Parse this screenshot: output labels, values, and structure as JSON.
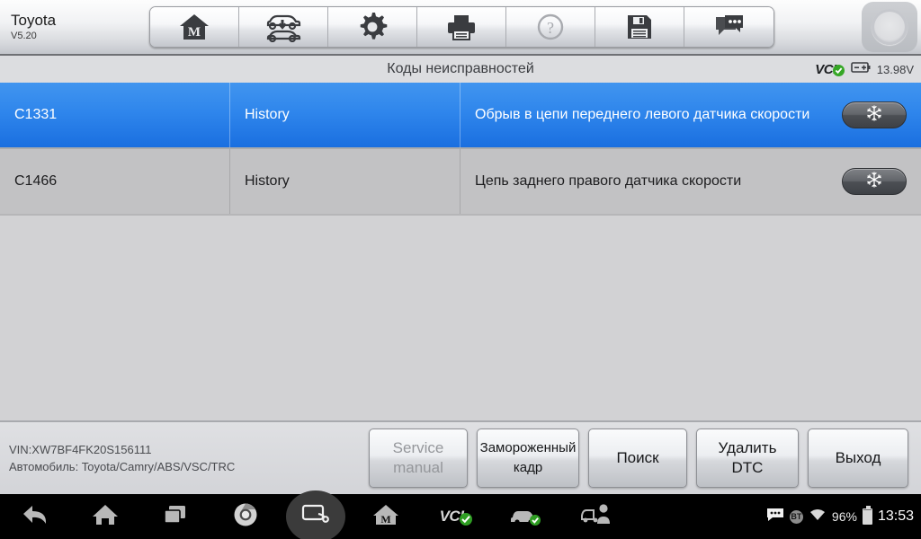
{
  "header": {
    "brand": "Toyota",
    "version": "V5.20",
    "buttons": [
      {
        "name": "home-m",
        "icon": "home-m-icon",
        "label": "Home"
      },
      {
        "name": "vehicle-swap",
        "icon": "vehicle-swap-icon",
        "label": "Vehicle"
      },
      {
        "name": "settings",
        "icon": "gear-icon",
        "label": "Settings"
      },
      {
        "name": "print",
        "icon": "printer-icon",
        "label": "Print"
      },
      {
        "name": "help",
        "icon": "question-icon",
        "label": "Help"
      },
      {
        "name": "save",
        "icon": "floppy-icon",
        "label": "Save"
      },
      {
        "name": "feedback",
        "icon": "chat-icon",
        "label": "Feedback"
      }
    ],
    "power_button_label": "Power"
  },
  "titlebar": {
    "title": "Коды неисправностей",
    "vci_label": "VCI",
    "vci_connected": true,
    "battery_voltage": "13.98V"
  },
  "dtc_table": {
    "rows": [
      {
        "code": "C1331",
        "status": "History",
        "description": "Обрыв в цепи переднего левого датчика скорости",
        "freeze_icon": "snowflake-icon",
        "selected": true
      },
      {
        "code": "C1466",
        "status": "History",
        "description": "Цепь заднего правого датчика скорости",
        "freeze_icon": "snowflake-icon",
        "selected": false
      }
    ]
  },
  "footer": {
    "vin": "VIN:XW7BF4FK20S156111",
    "vehicle": "Автомобиль: Toyota/Camry/ABS/VSC/TRC",
    "buttons": [
      {
        "label": "Service manual",
        "disabled": true
      },
      {
        "label": "Замороженный кадр",
        "disabled": false
      },
      {
        "label": "Поиск",
        "disabled": false
      },
      {
        "label": "Удалить DTC",
        "disabled": false
      },
      {
        "label": "Выход",
        "disabled": false
      }
    ]
  },
  "navbar": {
    "items": [
      {
        "name": "back",
        "icon": "back-arrow-icon"
      },
      {
        "name": "home",
        "icon": "home-icon"
      },
      {
        "name": "recents",
        "icon": "recents-icon"
      },
      {
        "name": "browser",
        "icon": "chrome-icon"
      },
      {
        "name": "screenshot",
        "icon": "screenshot-icon",
        "highlighted": true
      },
      {
        "name": "diag-home",
        "icon": "home-m-icon"
      },
      {
        "name": "vci-status",
        "icon": "vci-check-icon",
        "label": "VCI"
      },
      {
        "name": "vehicle-status",
        "icon": "car-check-icon"
      },
      {
        "name": "remote-support",
        "icon": "technician-icon"
      }
    ],
    "status": {
      "messages_icon": "message-icon",
      "bluetooth_label": "BT",
      "wifi_icon": "wifi-icon",
      "battery_percent": "96%",
      "clock": "13:53"
    }
  },
  "colors": {
    "selected_row": "#2f86ec",
    "row_bg": "#c2c2c4",
    "content_bg": "#d2d2d4",
    "status_ok": "#36a726"
  }
}
